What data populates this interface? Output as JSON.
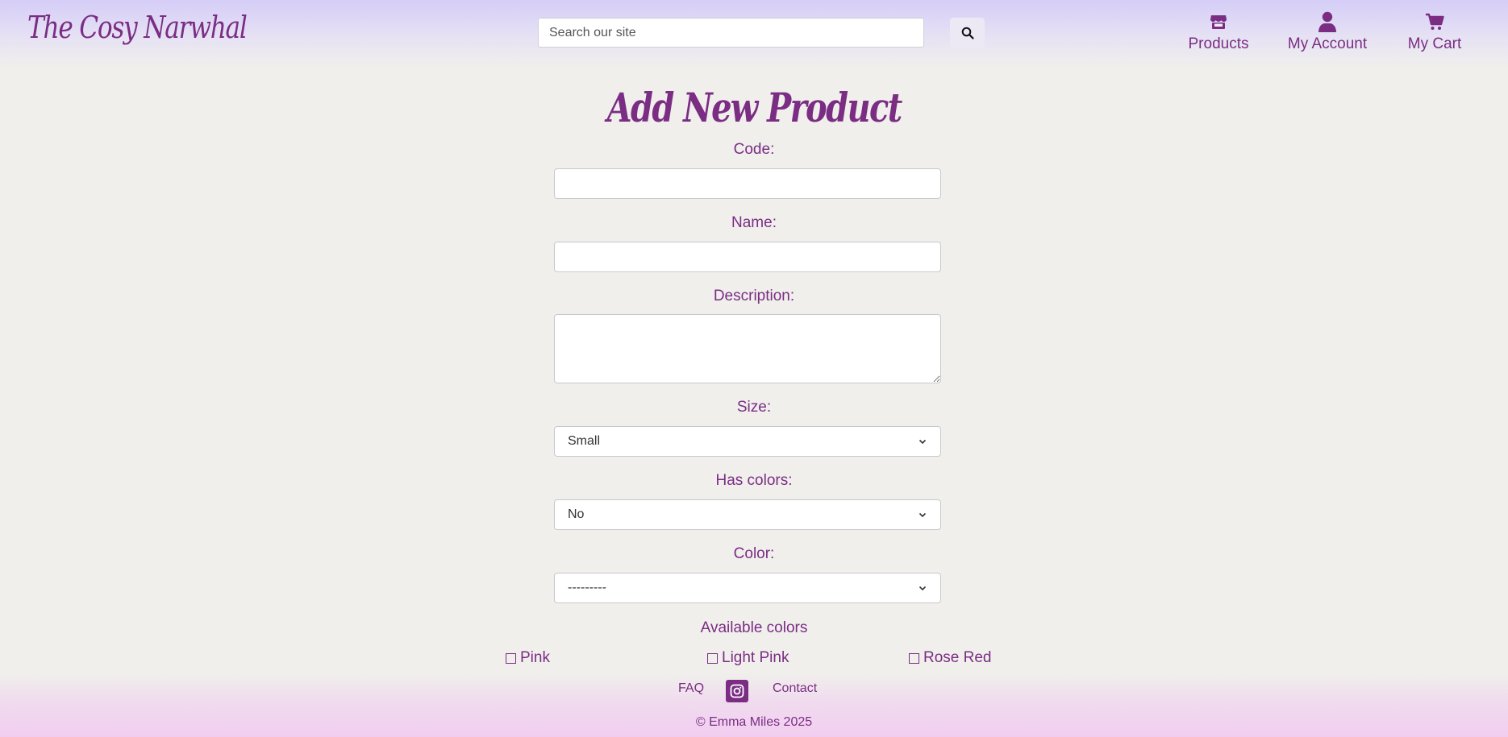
{
  "header": {
    "logo": "The Cosy Narwhal",
    "search_placeholder": "Search our site",
    "nav": {
      "products": "Products",
      "account": "My Account",
      "cart": "My Cart"
    }
  },
  "page": {
    "title": "Add New Product"
  },
  "form": {
    "code_label": "Code:",
    "name_label": "Name:",
    "description_label": "Description:",
    "size_label": "Size:",
    "size_value": "Small",
    "has_colors_label": "Has colors:",
    "has_colors_value": "No",
    "color_label": "Color:",
    "color_value": "---------",
    "available_colors_heading": "Available colors",
    "available_colors": [
      "Pink",
      "Light Pink",
      "Rose Red"
    ]
  },
  "footer": {
    "faq": "FAQ",
    "contact": "Contact",
    "copyright": "© Emma Miles 2025"
  },
  "colors": {
    "accent": "#7b2d84",
    "background": "#f0efec",
    "header_top": "#d5cdf7",
    "footer_bottom": "#f2cdf1"
  },
  "icons": [
    "search-icon",
    "store-icon",
    "user-icon",
    "cart-icon",
    "instagram-icon",
    "chevron-down-icon"
  ]
}
